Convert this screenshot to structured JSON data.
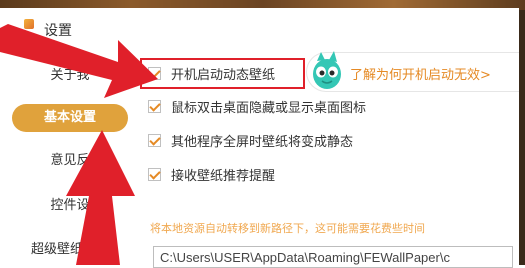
{
  "window": {
    "title": "设置",
    "icon": "app-logo-icon"
  },
  "sidebar": {
    "items": [
      {
        "label": "关于我",
        "active": false
      },
      {
        "label": "基本设置",
        "active": true
      },
      {
        "label": "意见反",
        "active": false
      },
      {
        "label": "控件设",
        "active": false
      },
      {
        "label": "超级壁纸设置",
        "active": false
      }
    ]
  },
  "settings": [
    {
      "label": "开机启动动态壁纸",
      "checked": true,
      "highlighted": true
    },
    {
      "label": "鼠标双击桌面隐藏或显示桌面图标",
      "checked": true
    },
    {
      "label": "其他程序全屏时壁纸将变成静态",
      "checked": true
    },
    {
      "label": "接收壁纸推荐提醒",
      "checked": true
    }
  ],
  "help": {
    "link_text": "了解为何开机启动无效>",
    "mascot_icon": "mascot-icon"
  },
  "storage": {
    "hint": "将本地资源自动转移到新路径下，这可能需要花费些时间",
    "path_value": "C:\\Users\\USER\\AppData\\Roaming\\FEWallPaper\\c"
  },
  "colors": {
    "accent": "#e0a23c",
    "link": "#e58a25",
    "highlight_border": "#e0202a",
    "annotation_arrow": "#e0202a"
  },
  "annotations": {
    "arrow_icon": "red-arrow-icon"
  }
}
